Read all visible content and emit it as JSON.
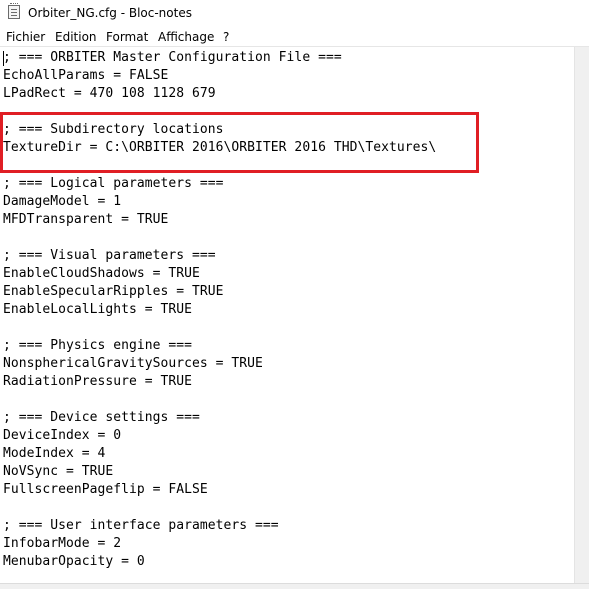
{
  "window": {
    "title": "Orbiter_NG.cfg - Bloc-notes",
    "icon": "notepad-icon"
  },
  "menu": {
    "items": [
      "Fichier",
      "Edition",
      "Format",
      "Affichage",
      "?"
    ]
  },
  "editor": {
    "lines": [
      "; === ORBITER Master Configuration File ===",
      "EchoAllParams = FALSE",
      "LPadRect = 470 108 1128 679",
      "",
      "; === Subdirectory locations",
      "TextureDir = C:\\ORBITER 2016\\ORBITER 2016 THD\\Textures\\",
      "",
      "; === Logical parameters ===",
      "DamageModel = 1",
      "MFDTransparent = TRUE",
      "",
      "; === Visual parameters ===",
      "EnableCloudShadows = TRUE",
      "EnableSpecularRipples = TRUE",
      "EnableLocalLights = TRUE",
      "",
      "; === Physics engine ===",
      "NonsphericalGravitySources = TRUE",
      "RadiationPressure = TRUE",
      "",
      "; === Device settings ===",
      "DeviceIndex = 0",
      "ModeIndex = 4",
      "NoVSync = TRUE",
      "FullscreenPageflip = FALSE",
      "",
      "; === User interface parameters ===",
      "InfobarMode = 2",
      "MenubarOpacity = 0"
    ]
  },
  "annotation": {
    "color": "#e01e24"
  }
}
